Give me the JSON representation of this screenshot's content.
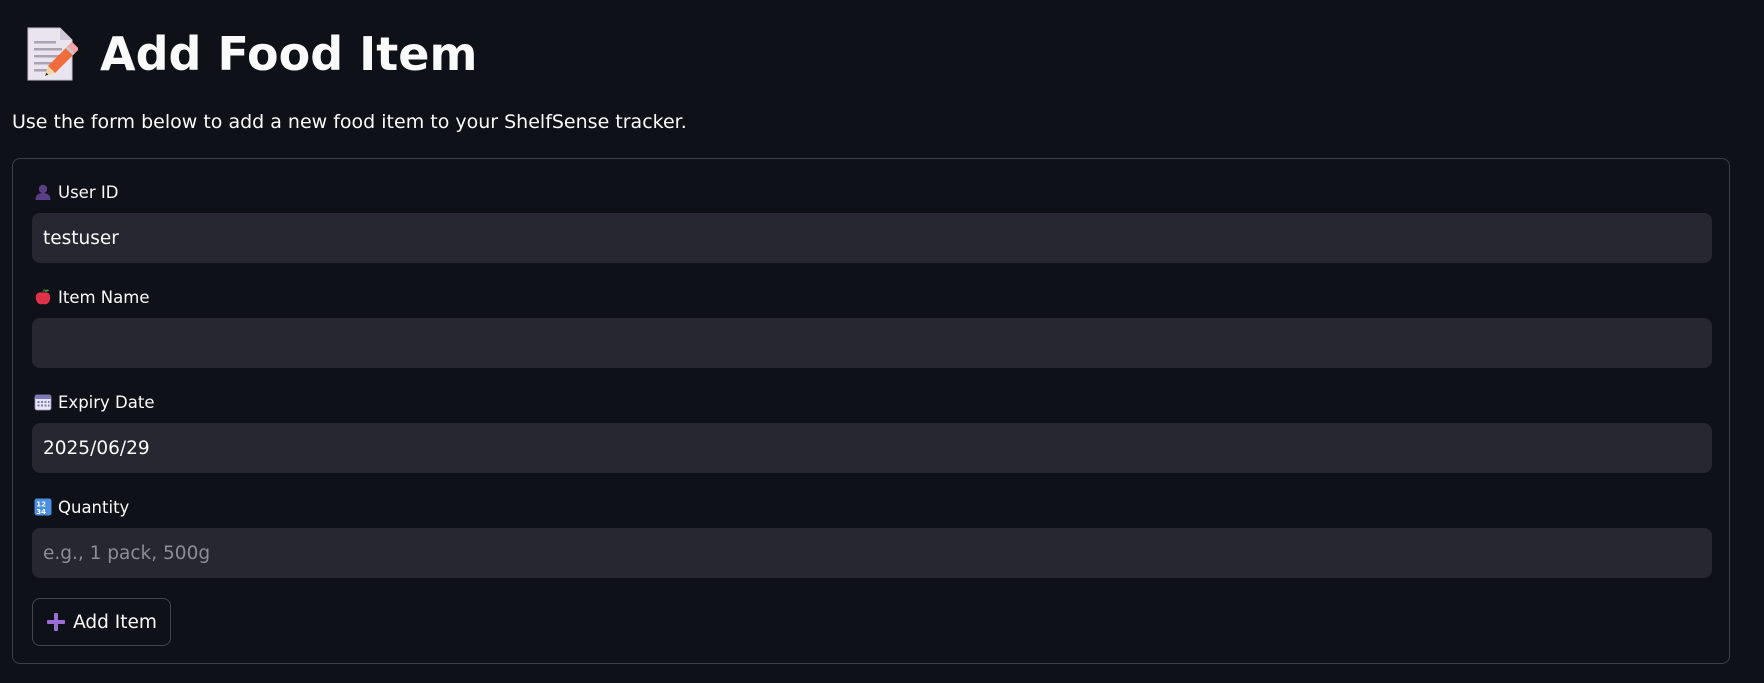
{
  "header": {
    "title": "Add Food Item",
    "icon": "memo-icon",
    "subtitle": "Use the form below to add a new food item to your ShelfSense tracker."
  },
  "form": {
    "user_id": {
      "label": "User ID",
      "icon": "user-silhouette-icon",
      "value": "testuser"
    },
    "item_name": {
      "label": "Item Name",
      "icon": "apple-icon",
      "value": "",
      "placeholder": ""
    },
    "expiry_date": {
      "label": "Expiry Date",
      "icon": "calendar-icon",
      "value": "2025/06/29"
    },
    "quantity": {
      "label": "Quantity",
      "icon": "numbers-icon",
      "value": "",
      "placeholder": "e.g., 1 pack, 500g"
    },
    "submit": {
      "label": "Add Item",
      "icon": "plus-icon"
    }
  },
  "colors": {
    "background": "#0e1117",
    "input_background": "#262730",
    "text": "#fafafa",
    "placeholder": "#8a8d93",
    "plus_accent": "#9b6bd6"
  }
}
